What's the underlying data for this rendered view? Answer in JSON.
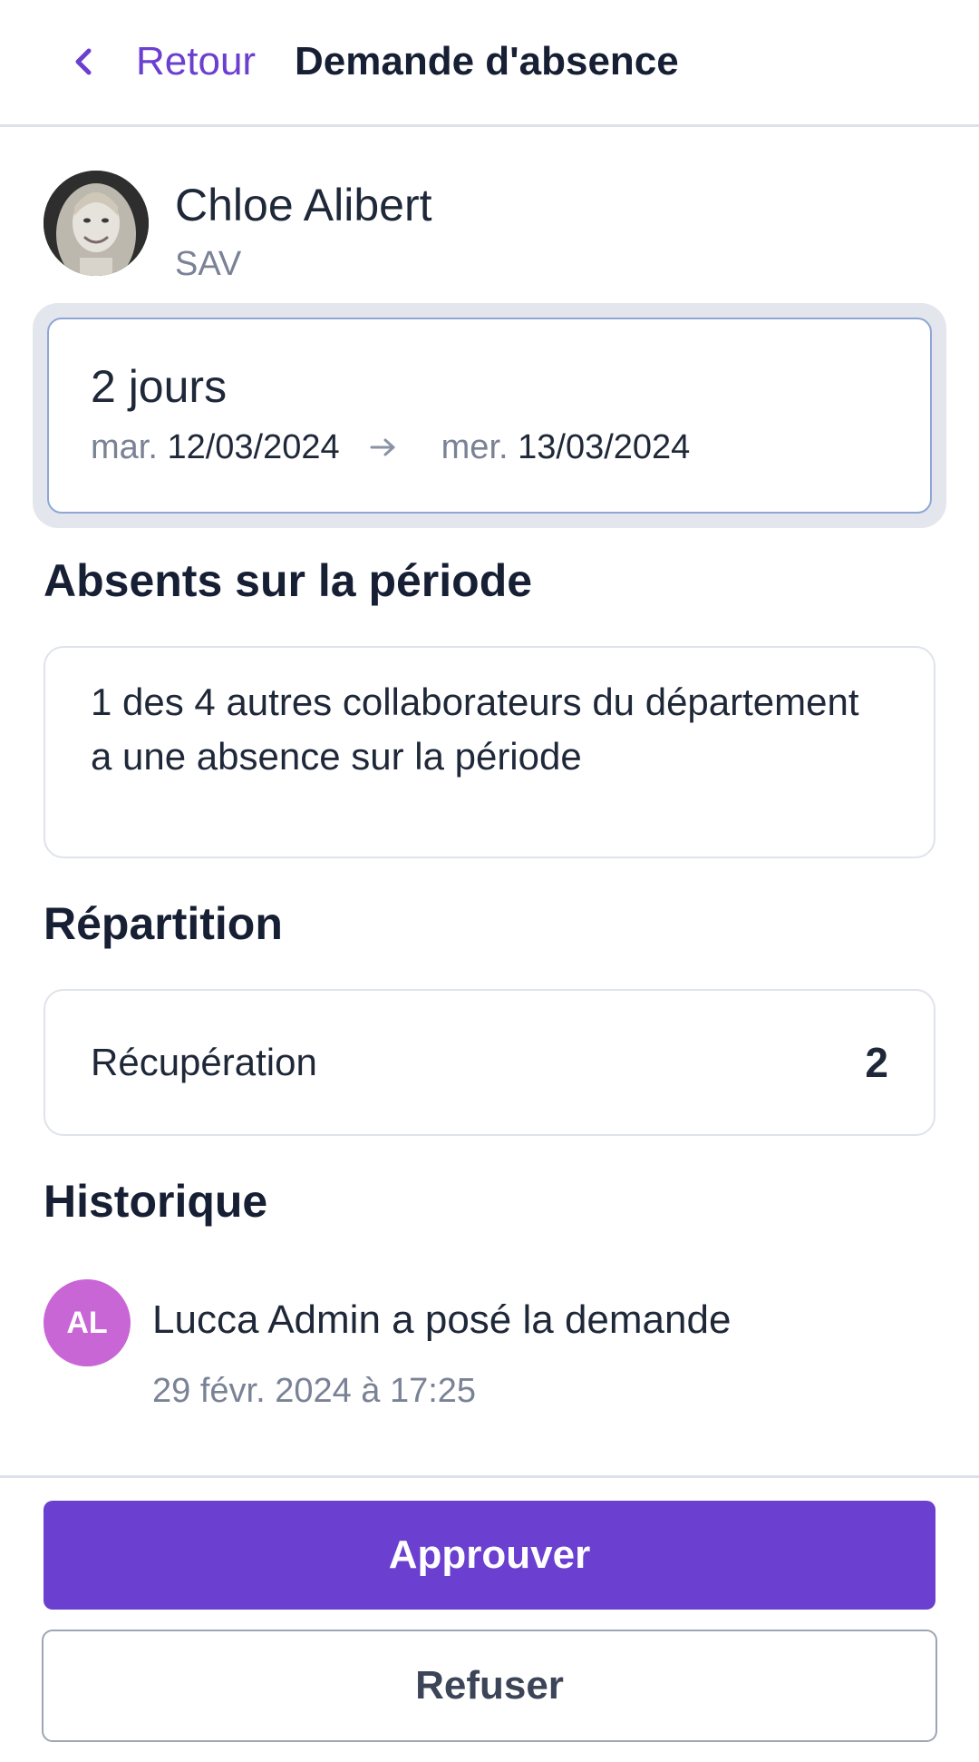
{
  "header": {
    "back_label": "Retour",
    "title": "Demande d'absence",
    "back_icon": "chevron-left-icon"
  },
  "user": {
    "name": "Chloe Alibert",
    "department": "SAV",
    "avatar_icon": "user-photo"
  },
  "period": {
    "duration": "2 jours",
    "start_day": "mar.",
    "start_date": "12/03/2024",
    "end_day": "mer.",
    "end_date": "13/03/2024",
    "arrow_icon": "arrow-right-icon"
  },
  "absents": {
    "title": "Absents sur la période",
    "text": "1 des 4 autres collaborateurs du département a une absence sur la période"
  },
  "repartition": {
    "title": "Répartition",
    "items": [
      {
        "label": "Récupération",
        "value": "2"
      }
    ]
  },
  "historique": {
    "title": "Historique",
    "entries": [
      {
        "initials": "AL",
        "text": "Lucca Admin a posé la demande",
        "date": "29 févr. 2024 à 17:25",
        "avatar_color": "#c866d6"
      }
    ]
  },
  "actions": {
    "approve_label": "Approuver",
    "refuse_label": "Refuser",
    "accent_color": "#6b3fcf"
  }
}
